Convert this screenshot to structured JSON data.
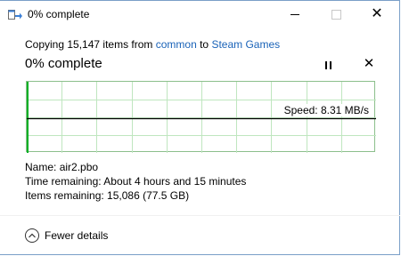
{
  "window": {
    "title": "0% complete",
    "icons": {
      "app": "file-copy-icon",
      "minimize": "minimize-icon",
      "maximize": "maximize-icon",
      "close": "close-icon"
    }
  },
  "copy": {
    "prefix": "Copying 15,147 items from ",
    "source": "common",
    "middle": " to ",
    "destination": "Steam Games",
    "heading": "0% complete",
    "progress_percent": 0,
    "pause_icon": "pause-icon",
    "cancel_icon": "cancel-icon",
    "speed": "Speed: 8.31 MB/s"
  },
  "details": {
    "name_label": "Name:",
    "name_value": "air2.pbo",
    "time_label": "Time remaining:",
    "time_value": "About 4 hours and 15 minutes",
    "items_label": "Items remaining:",
    "items_value": "15,086 (77.5 GB)"
  },
  "footer": {
    "fewer_label": "Fewer details",
    "icon": "chevron-up-icon"
  },
  "colors": {
    "link": "#1a63b8",
    "graph_grid": "#bfe6bf",
    "graph_border": "#8cbf8c",
    "speed_line": "#000000",
    "progress_fill": "#06b025"
  }
}
